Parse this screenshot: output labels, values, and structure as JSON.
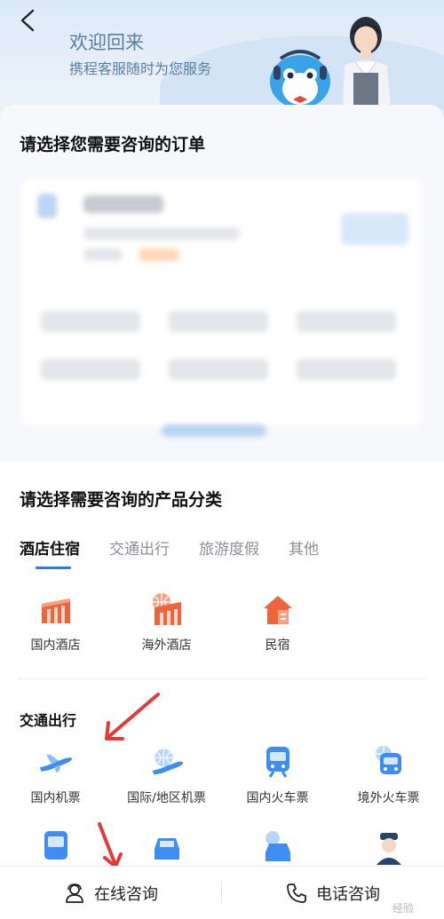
{
  "header": {
    "welcome_title": "欢迎回来",
    "welcome_subtitle": "携程客服随时为您服务"
  },
  "order_section": {
    "title": "请选择您需要咨询的订单"
  },
  "product_section": {
    "title": "请选择需要咨询的产品分类",
    "tabs": [
      {
        "label": "酒店住宿",
        "active": true
      },
      {
        "label": "交通出行",
        "active": false
      },
      {
        "label": "旅游度假",
        "active": false
      },
      {
        "label": "其他",
        "active": false
      }
    ],
    "hotel_items": [
      {
        "label": "国内酒店",
        "icon": "domestic-hotel-icon"
      },
      {
        "label": "海外酒店",
        "icon": "overseas-hotel-icon"
      },
      {
        "label": "民宿",
        "icon": "homestay-icon"
      }
    ],
    "transport_title": "交通出行",
    "transport_items": [
      {
        "label": "国内机票",
        "icon": "plane-icon"
      },
      {
        "label": "国际/地区机票",
        "icon": "globe-plane-icon"
      },
      {
        "label": "国内火车票",
        "icon": "train-icon"
      },
      {
        "label": "境外火车票",
        "icon": "globe-train-icon"
      }
    ]
  },
  "bottom_bar": {
    "online_label": "在线咨询",
    "phone_label": "电话咨询"
  },
  "watermark": "经验",
  "colors": {
    "accent": "#2c7be5",
    "hotel_icon": "#f0643c",
    "transport_icon": "#3d8ef0",
    "arrow": "#e03b3b"
  }
}
